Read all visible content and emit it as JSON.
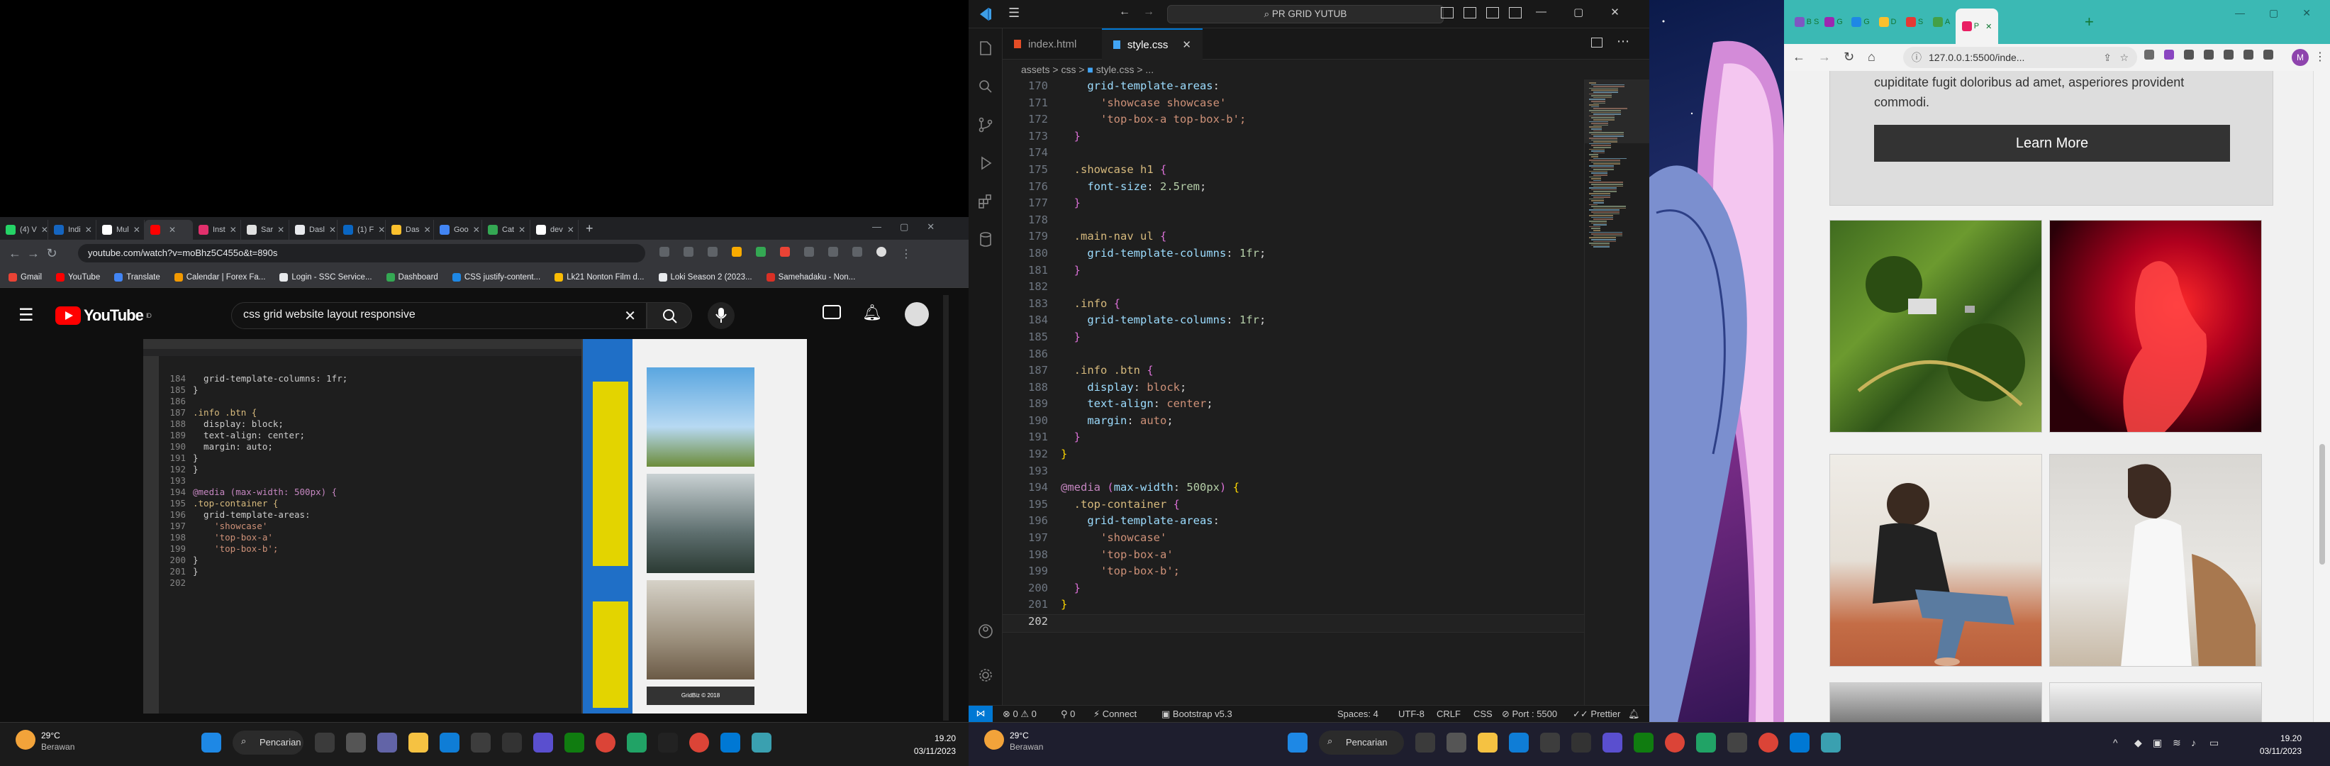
{
  "left_monitor": {
    "browser": {
      "tabs": [
        {
          "label": "(4) V",
          "color": "#25d366"
        },
        {
          "label": "Indi",
          "color": "#1565c0"
        },
        {
          "label": "Mul",
          "color": "#ffffff"
        },
        {
          "label": "",
          "color": "#ff0000",
          "active": true
        },
        {
          "label": "Inst",
          "color": "#e1306c"
        },
        {
          "label": "Sar",
          "color": "#e0e0e0"
        },
        {
          "label": "Dasl",
          "color": "#e8eaed"
        },
        {
          "label": "(1) F",
          "color": "#0a66c2"
        },
        {
          "label": "Das",
          "color": "#fbc02d"
        },
        {
          "label": "Goo",
          "color": "#4285f4"
        },
        {
          "label": "Cat",
          "color": "#34a853"
        },
        {
          "label": "dev",
          "color": "#ffffff"
        }
      ],
      "new_tab": "+",
      "url": "youtube.com/watch?v=moBhz5C455o&t=890s",
      "bookmarks": [
        "Gmail",
        "YouTube",
        "Translate",
        "Calendar | Forex Fa...",
        "Login - SSC Service...",
        "Dashboard",
        "CSS justify-content...",
        "Lk21 Nonton Film d...",
        "Loki Season 2 (2023...",
        "Samehadaku - Non..."
      ],
      "youtube": {
        "brand": "YouTube",
        "region": "ID",
        "search_value": "css grid website layout responsive"
      },
      "video_code": [
        {
          "n": "184",
          "t": "  grid-template-columns: 1fr;"
        },
        {
          "n": "185",
          "t": "}"
        },
        {
          "n": "186",
          "t": ""
        },
        {
          "n": "187",
          "t": ".info .btn {"
        },
        {
          "n": "188",
          "t": "  display: block;"
        },
        {
          "n": "189",
          "t": "  text-align: center;"
        },
        {
          "n": "190",
          "t": "  margin: auto;"
        },
        {
          "n": "191",
          "t": "}"
        },
        {
          "n": "192",
          "t": "}"
        },
        {
          "n": "193",
          "t": ""
        },
        {
          "n": "194",
          "t": "@media (max-width: 500px) {"
        },
        {
          "n": "195",
          "t": ".top-container {"
        },
        {
          "n": "196",
          "t": "  grid-template-areas:"
        },
        {
          "n": "197",
          "t": "    'showcase'"
        },
        {
          "n": "198",
          "t": "    'top-box-a'"
        },
        {
          "n": "199",
          "t": "    'top-box-b';"
        },
        {
          "n": "200",
          "t": "}"
        },
        {
          "n": "201",
          "t": "}"
        },
        {
          "n": "202",
          "t": ""
        }
      ],
      "mini_web_footer": "GridBiz © 2018"
    },
    "taskbar": {
      "temp": "29°C",
      "weather": "Berawan",
      "search": "Pencarian",
      "time": "19.20",
      "date": "03/11/2023"
    }
  },
  "vscode": {
    "title": "PR GRID YUTUB",
    "tabs": [
      {
        "label": "index.html",
        "icon_color": "#e44d26"
      },
      {
        "label": "style.css",
        "icon_color": "#42a5f5",
        "active": true
      }
    ],
    "breadcrumb": [
      "assets",
      "css",
      "style.css",
      "..."
    ],
    "lines": [
      {
        "n": "170",
        "t": "    grid-template-areas:"
      },
      {
        "n": "171",
        "t": "      'showcase showcase'"
      },
      {
        "n": "172",
        "t": "      'top-box-a top-box-b';"
      },
      {
        "n": "173",
        "t": "  }"
      },
      {
        "n": "174",
        "t": ""
      },
      {
        "n": "175",
        "t": "  .showcase h1 {"
      },
      {
        "n": "176",
        "t": "    font-size: 2.5rem;"
      },
      {
        "n": "177",
        "t": "  }"
      },
      {
        "n": "178",
        "t": ""
      },
      {
        "n": "179",
        "t": "  .main-nav ul {"
      },
      {
        "n": "180",
        "t": "    grid-template-columns: 1fr;"
      },
      {
        "n": "181",
        "t": "  }"
      },
      {
        "n": "182",
        "t": ""
      },
      {
        "n": "183",
        "t": "  .info {"
      },
      {
        "n": "184",
        "t": "    grid-template-columns: 1fr;"
      },
      {
        "n": "185",
        "t": "  }"
      },
      {
        "n": "186",
        "t": ""
      },
      {
        "n": "187",
        "t": "  .info .btn {"
      },
      {
        "n": "188",
        "t": "    display: block;"
      },
      {
        "n": "189",
        "t": "    text-align: center;"
      },
      {
        "n": "190",
        "t": "    margin: auto;"
      },
      {
        "n": "191",
        "t": "  }"
      },
      {
        "n": "192",
        "t": "}"
      },
      {
        "n": "193",
        "t": ""
      },
      {
        "n": "194",
        "t": "@media (max-width: 500px) {"
      },
      {
        "n": "195",
        "t": "  .top-container {"
      },
      {
        "n": "196",
        "t": "    grid-template-areas:"
      },
      {
        "n": "197",
        "t": "      'showcase'"
      },
      {
        "n": "198",
        "t": "      'top-box-a'"
      },
      {
        "n": "199",
        "t": "      'top-box-b';"
      },
      {
        "n": "200",
        "t": "  }"
      },
      {
        "n": "201",
        "t": "}"
      },
      {
        "n": "202",
        "t": ""
      }
    ],
    "status": {
      "errors": "0",
      "warnings": "0",
      "ports": "0",
      "connect": "Connect",
      "bootstrap": "Bootstrap v5.3",
      "spaces": "Spaces: 4",
      "encoding": "UTF-8",
      "eol": "CRLF",
      "lang": "CSS",
      "port": "Port : 5500",
      "prettier": "Prettier"
    }
  },
  "right_browser": {
    "tabs": [
      "B S",
      "G",
      "G",
      "D",
      "S",
      "A",
      "P"
    ],
    "url": "127.0.0.1:5500/inde...",
    "profile": "M",
    "box_text": "cupiditate fugit doloribus ad amet, asperiores provident commodi.",
    "button": "Learn More"
  },
  "right_taskbar": {
    "temp": "29°C",
    "weather": "Berawan",
    "search": "Pencarian",
    "time": "19.20",
    "date": "03/11/2023"
  }
}
